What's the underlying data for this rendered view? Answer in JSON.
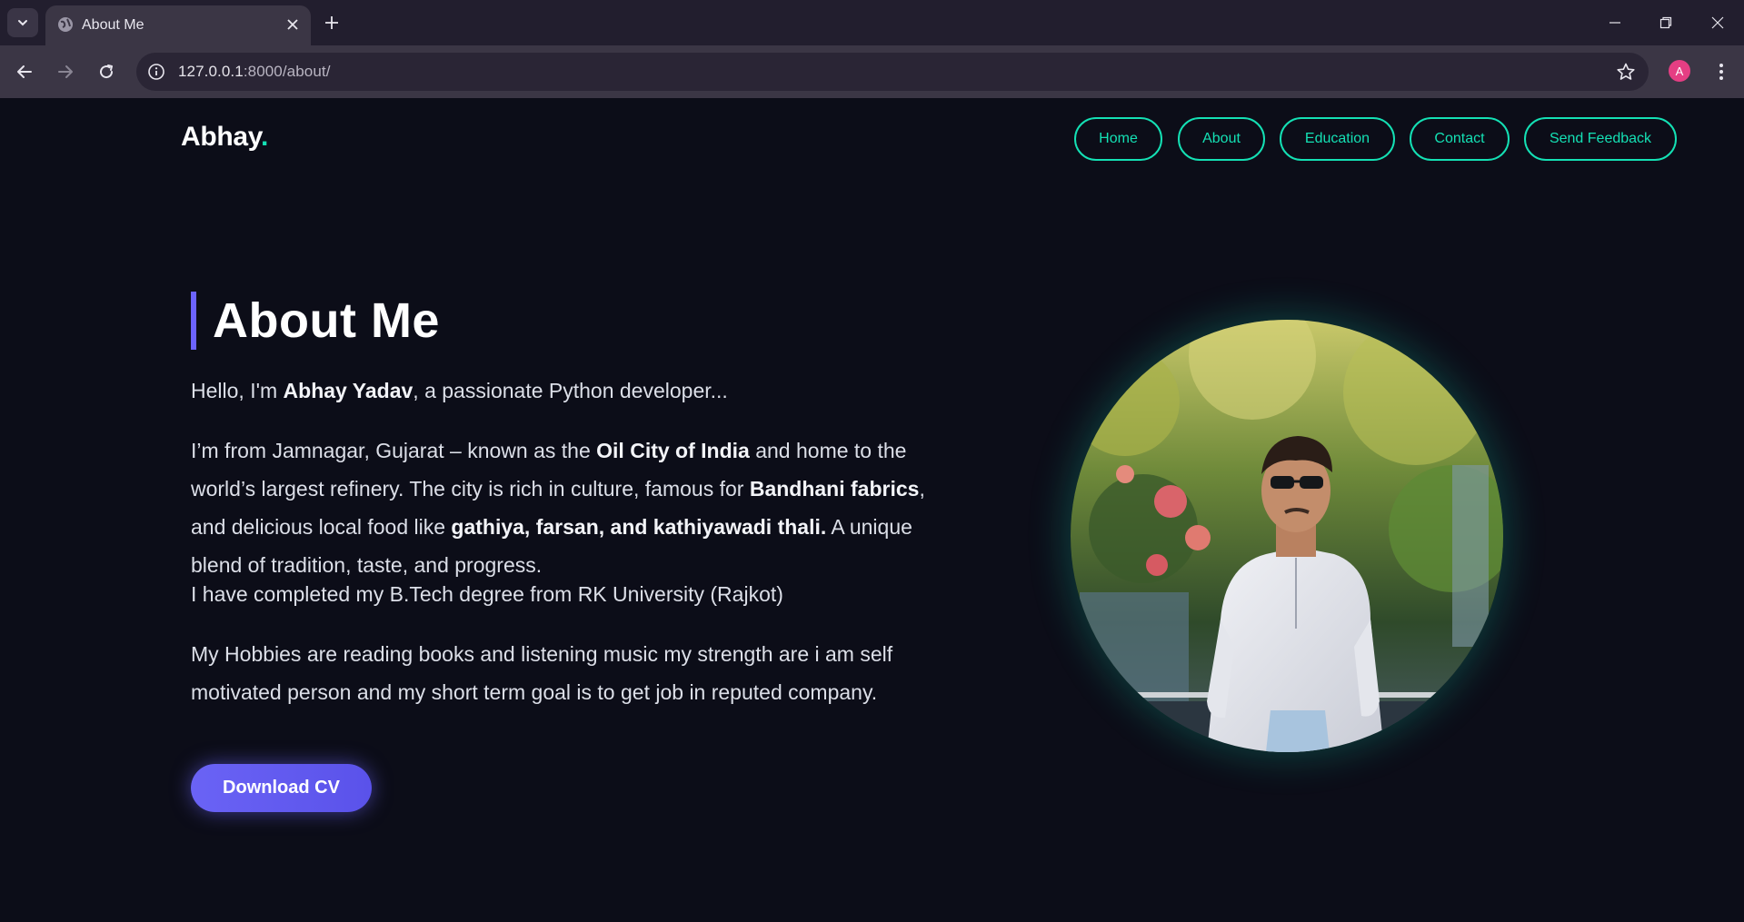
{
  "browser": {
    "tab_title": "About Me",
    "url_host": "127.0.0.1",
    "url_path": ":8000/about/",
    "profile_initial": "A"
  },
  "site": {
    "brand": "Abhay",
    "brand_dot": ".",
    "nav": [
      "Home",
      "About",
      "Education",
      "Contact",
      "Send Feedback"
    ]
  },
  "about": {
    "heading": "About Me",
    "intro_prefix": "Hello, I'm ",
    "intro_name": "Abhay Yadav",
    "intro_suffix": ", a passionate Python developer...",
    "p2_a": "I’m from Jamnagar, Gujarat – known as the ",
    "p2_b": "Oil City of India",
    "p2_c": " and home to the world’s largest refinery. The city is rich in culture, famous for ",
    "p2_d": "Bandhani fabrics",
    "p2_e": ", and delicious local food like ",
    "p2_f": "gathiya, farsan, and kathiyawadi thali.",
    "p2_g": " A unique blend of tradition, taste, and progress.",
    "p3": "I have completed my B.Tech degree from RK University (Rajkot)",
    "p4": "My Hobbies are reading books and listening music my strength are i am self motivated person and my short term goal is to get job in reputed company.",
    "cv_button": "Download CV"
  },
  "colors": {
    "accent_teal": "#14e0b4",
    "accent_purple": "#6c63ff",
    "background": "#0c0d18"
  },
  "icons": [
    "tab-list-icon",
    "globe-icon",
    "close-icon",
    "plus-icon",
    "minimize-icon",
    "restore-icon",
    "window-close-icon",
    "back-icon",
    "forward-icon",
    "reload-icon",
    "info-icon",
    "star-icon",
    "more-icon"
  ]
}
